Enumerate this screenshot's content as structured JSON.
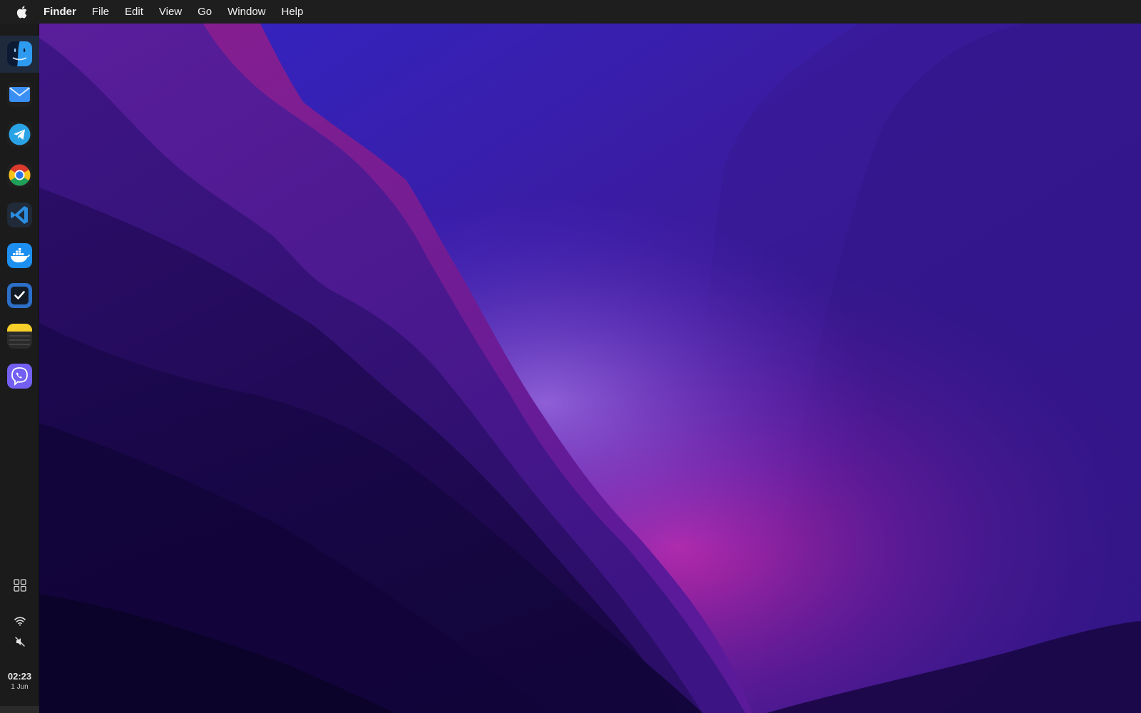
{
  "menubar": {
    "app_name": "Finder",
    "items": [
      {
        "label": "File"
      },
      {
        "label": "Edit"
      },
      {
        "label": "View"
      },
      {
        "label": "Go"
      },
      {
        "label": "Window"
      },
      {
        "label": "Help"
      }
    ]
  },
  "dock": {
    "apps": [
      {
        "name": "Finder",
        "icon": "finder-icon",
        "active": true
      },
      {
        "name": "Mail",
        "icon": "mail-icon"
      },
      {
        "name": "Telegram",
        "icon": "telegram-icon"
      },
      {
        "name": "Google Chrome",
        "icon": "chrome-icon"
      },
      {
        "name": "Visual Studio Code",
        "icon": "vscode-icon"
      },
      {
        "name": "Docker",
        "icon": "docker-icon"
      },
      {
        "name": "Tasks",
        "icon": "checkmark-icon"
      },
      {
        "name": "Notes",
        "icon": "notes-icon"
      },
      {
        "name": "Viber",
        "icon": "viber-icon"
      }
    ],
    "status": {
      "launchpad_icon": "grid-icon",
      "wifi_icon": "wifi-icon",
      "sound_icon": "muted-speaker-icon",
      "time": "02:23",
      "date": "1 Jun"
    }
  },
  "colors": {
    "menubar_bg": "#1e1e1e",
    "dock_bg": "#1b1b1b",
    "wallpaper_primary": "#3a1a8c",
    "wallpaper_accent": "#b0249a"
  }
}
